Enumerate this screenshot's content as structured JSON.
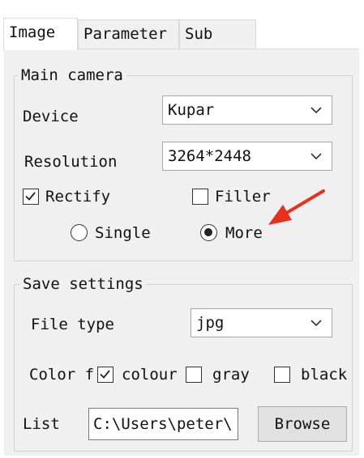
{
  "tabs": [
    {
      "label": "Image",
      "active": true
    },
    {
      "label": "Parameter",
      "active": false
    },
    {
      "label": "Sub",
      "active": false
    }
  ],
  "main_camera": {
    "title": "Main camera",
    "device_label": "Device",
    "device_value": "Kupar",
    "resolution_label": "Resolution",
    "resolution_value": "3264*2448",
    "rectify_label": "Rectify",
    "rectify_checked": true,
    "filler_label": "Filler",
    "filler_checked": false,
    "mode_options": [
      {
        "label": "Single",
        "selected": false
      },
      {
        "label": "More",
        "selected": true
      }
    ]
  },
  "save_settings": {
    "title": "Save settings",
    "file_type_label": "File type",
    "file_type_value": "jpg",
    "color_label": "Color f",
    "color_options": [
      {
        "label": "colour",
        "checked": true
      },
      {
        "label": "gray",
        "checked": false
      },
      {
        "label": "black",
        "checked": false
      }
    ],
    "list_label": "List",
    "list_path": "C:\\Users\\peter\\",
    "browse_label": "Browse"
  },
  "annotation": {
    "arrow_color": "#e8301e"
  }
}
